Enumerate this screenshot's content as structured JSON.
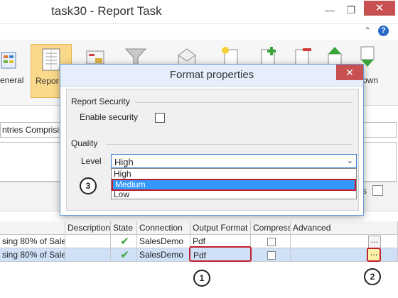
{
  "window": {
    "title": "task30 - Report Task",
    "minimize_glyph": "—",
    "restore_glyph": "❐",
    "close_glyph": "✕",
    "collapse_glyph": "⌃",
    "help_glyph": "?"
  },
  "ribbon": {
    "general_label": "eneral",
    "report_label": "Repor",
    "down_label": "own"
  },
  "background": {
    "textbox_value": "ntries Comprisin",
    "s_label": "s"
  },
  "grid": {
    "columns": [
      "Description",
      "State",
      "Connection",
      "Output Format",
      "Compress",
      "Advanced"
    ],
    "rows": [
      {
        "name": "sing 80% of Sales",
        "state": "✔",
        "connection": "SalesDemo",
        "format": "Pdf",
        "advanced": "..."
      },
      {
        "name": "sing 80% of Sales",
        "state": "✔",
        "connection": "SalesDemo",
        "format": "Pdf",
        "advanced": "..."
      }
    ]
  },
  "dialog": {
    "title": "Format properties",
    "close_glyph": "✕",
    "report_security_label": "Report Security",
    "enable_security_label": "Enable security",
    "quality_label": "Quality",
    "level_label": "Level",
    "level_value": "High",
    "dropdown_arrow": "⌄",
    "options": [
      "High",
      "Medium",
      "Low"
    ]
  },
  "callouts": {
    "c1": "1",
    "c2": "2",
    "c3": "3"
  },
  "colors": {
    "highlight": "#c02030",
    "selected_option": "#3399ff",
    "selected_row": "#cfe0f7",
    "check_green": "#3aa63a"
  }
}
